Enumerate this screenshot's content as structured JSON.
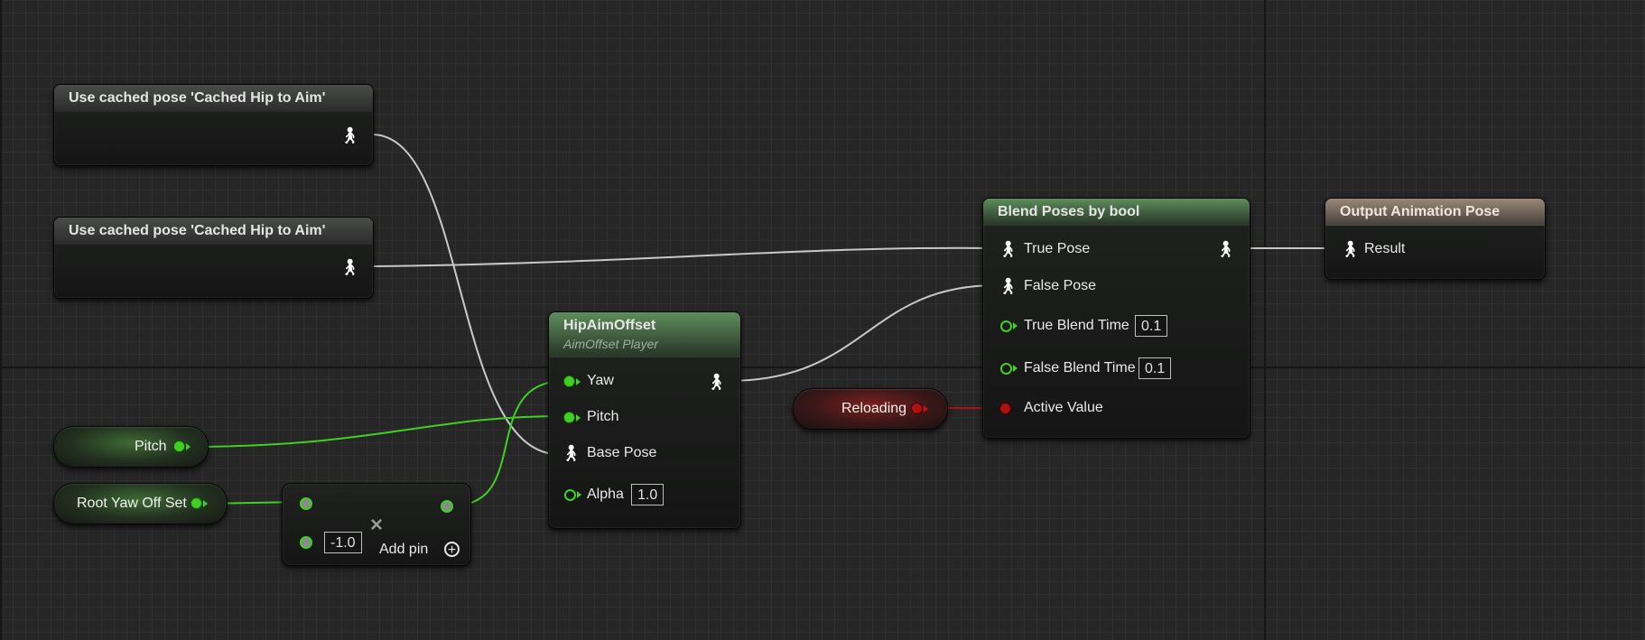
{
  "cached_pose_1": {
    "title": "Use cached pose 'Cached Hip to Aim'"
  },
  "cached_pose_2": {
    "title": "Use cached pose 'Cached Hip to Aim'"
  },
  "blend_poses": {
    "title": "Blend Poses by bool",
    "true_pose": "True Pose",
    "false_pose": "False Pose",
    "true_blend_time": "True Blend Time",
    "true_blend_time_value": "0.1",
    "false_blend_time": "False Blend Time",
    "false_blend_time_value": "0.1",
    "active_value": "Active Value"
  },
  "output_pose": {
    "title": "Output Animation Pose",
    "result": "Result"
  },
  "aim_offset": {
    "title": "HipAimOffset",
    "subtitle": "AimOffset Player",
    "yaw": "Yaw",
    "pitch": "Pitch",
    "base_pose": "Base Pose",
    "alpha": "Alpha",
    "alpha_value": "1.0"
  },
  "reloading_var": {
    "label": "Reloading"
  },
  "pitch_var": {
    "label": "Pitch"
  },
  "root_yaw_var": {
    "label": "Root Yaw Off Set"
  },
  "multiply_node": {
    "operator_symbol": "×",
    "value": "-1.0",
    "add_pin": "Add pin",
    "add_icon": "+"
  },
  "icons": {
    "pose": "pose-person-icon",
    "exec": "float-pin-icon",
    "bool": "bool-pin-icon"
  },
  "colors": {
    "float_pin": "#3fd022",
    "bool_pin": "#b01010",
    "pose_wire": "#c8c8c8",
    "header_green": "#5e8d5c",
    "header_tan": "#9a8878"
  }
}
